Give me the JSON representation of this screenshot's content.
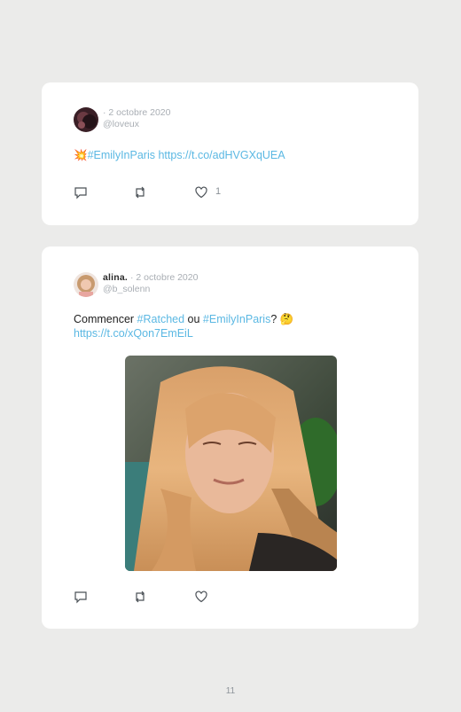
{
  "tweets": [
    {
      "name": "",
      "date": "· 2 octobre 2020",
      "handle": "@loveux",
      "emoji": "💥",
      "hashtag1": "#EmilyInParis",
      "url": "https://t.co/adHVGXqUEA",
      "likes": "1",
      "icons": [
        "reply-icon",
        "retweet-icon",
        "heart-icon"
      ]
    },
    {
      "name": "alina.",
      "date": "· 2 octobre 2020",
      "handle": "@b_solenn",
      "text_prefix": "Commencer ",
      "hashtag1": "#Ratched",
      "text_mid": " ou ",
      "hashtag2": "#EmilyInParis",
      "text_suffix": "? 🤔",
      "url": "https://t.co/xQon7EmEiL",
      "likes": "",
      "icons": [
        "reply-icon",
        "retweet-icon",
        "heart-icon"
      ]
    }
  ],
  "page": {
    "number": "11"
  },
  "colors": {
    "link": "#5bb8e3",
    "background": "#ebebea",
    "muted": "#a9aeb4"
  }
}
